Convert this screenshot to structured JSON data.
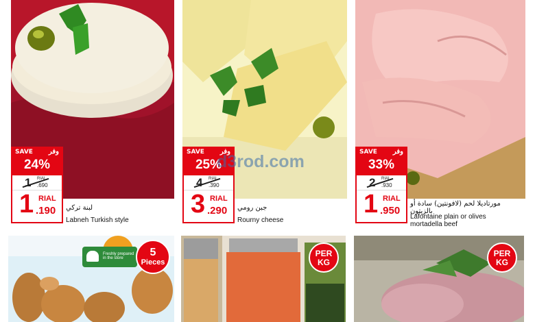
{
  "products": [
    {
      "name_ar": "لبنة تركي",
      "name_en": "Labneh Turkish style",
      "save_label": "SAVE",
      "save_label_ar": "وفر",
      "save_pct": "24%",
      "old_int": "1",
      "old_currency": "RIAL",
      "old_dec": ".690",
      "new_int": "1",
      "new_currency": "RIAL",
      "new_dec": ".190"
    },
    {
      "name_ar": "جبن رومي",
      "name_en": "Rourny cheese",
      "save_label": "SAVE",
      "save_label_ar": "وفر",
      "save_pct": "25%",
      "old_int": "4",
      "old_currency": "RIAL",
      "old_dec": ".390",
      "new_int": "3",
      "new_currency": "RIAL",
      "new_dec": ".290"
    },
    {
      "name_ar": "مورتاديلا لحم (لافونتين) سادة أو بالزيتون",
      "name_en": "Lafontaine plain or olives mortadella beef",
      "save_label": "SAVE",
      "save_label_ar": "وفر",
      "save_pct": "33%",
      "old_int": "2",
      "old_currency": "RIAL",
      "old_dec": ".930",
      "new_int": "1",
      "new_currency": "RIAL",
      "new_dec": ".950"
    }
  ],
  "bottom_badges": {
    "pieces_count": "5",
    "pieces_label": "Pieces",
    "per_kg_line1": "PER",
    "per_kg_line2": "KG",
    "per_kg2_line1": "PER",
    "per_kg2_line2": "KG",
    "fresh_label": "Freshly prepared in the store"
  },
  "watermark": "d3rod.com",
  "colors": {
    "accent": "#e30613",
    "text": "#111111"
  }
}
